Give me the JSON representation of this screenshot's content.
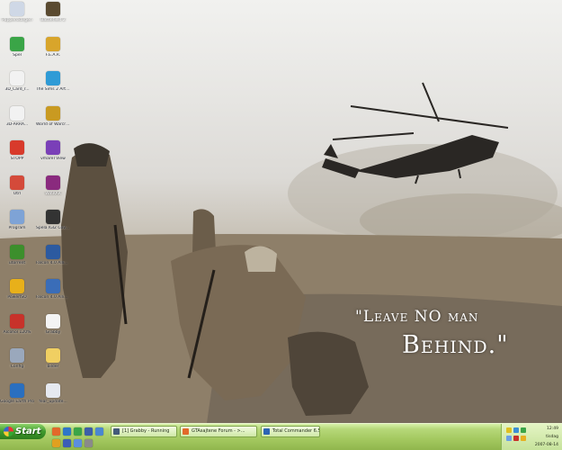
{
  "desktop": {
    "icons": [
      {
        "label": "Papperskorgen",
        "icon": "recycle-bin-icon",
        "color": "#cfd8e6",
        "light": true
      },
      {
        "label": "Battlefield 2",
        "icon": "battlefield-icon",
        "color": "#5a4a30",
        "light": true
      },
      {
        "label": "Spel",
        "icon": "globe-icon",
        "color": "#3aa547",
        "light": false
      },
      {
        "label": "F.E.A.R.",
        "icon": "fear-icon",
        "color": "#d8a52b",
        "light": false
      },
      {
        "label": "3D_Card_r...",
        "icon": "document-icon",
        "color": "#f2f2f2",
        "light": false
      },
      {
        "label": "The Sims 2 Artenliv",
        "icon": "sims-icon",
        "color": "#2f9bd6",
        "light": false
      },
      {
        "label": "3D-ARRA...",
        "icon": "document-icon",
        "color": "#f2f2f2",
        "light": false
      },
      {
        "label": "World of Warcraft",
        "icon": "warcraft-icon",
        "color": "#c99a21",
        "light": false
      },
      {
        "label": "STOPP",
        "icon": "power-icon",
        "color": "#d83a2b",
        "light": false
      },
      {
        "label": "vmareTView",
        "icon": "app-icon",
        "color": "#7a3fb8",
        "light": false
      },
      {
        "label": "Utrl",
        "icon": "shortcut-icon",
        "color": "#d44a3a",
        "light": false
      },
      {
        "label": "WinRAR",
        "icon": "winrar-icon",
        "color": "#8a2a7e",
        "light": true
      },
      {
        "label": "Program",
        "icon": "computer-icon",
        "color": "#7ea3d6",
        "light": false
      },
      {
        "label": "Spela IGI2 Covert Strike",
        "icon": "igi-icon",
        "color": "#333333",
        "light": false
      },
      {
        "label": "utorrent",
        "icon": "utorrent-icon",
        "color": "#3c8f2c",
        "light": false
      },
      {
        "label": "Falcon 4.0 Allied Force",
        "icon": "falcon-icon",
        "color": "#2c5aa0",
        "light": false
      },
      {
        "label": "PowerISO",
        "icon": "poweriso-icon",
        "color": "#e8b01a",
        "light": false
      },
      {
        "label": "Falcon 4.0 Allied Fo...",
        "icon": "falcon-icon",
        "color": "#3a6db8",
        "light": false
      },
      {
        "label": "Alcohol 120%",
        "icon": "alcohol-icon",
        "color": "#c8322a",
        "light": false
      },
      {
        "label": "Grabby",
        "icon": "grabby-icon",
        "color": "#f4f4f4",
        "light": false
      },
      {
        "label": "Config",
        "icon": "config-icon",
        "color": "#9aa8bc",
        "light": false
      },
      {
        "label": "bilder",
        "icon": "folder-icon",
        "color": "#f0cf62",
        "light": false
      },
      {
        "label": "Google Earth Pro",
        "icon": "google-earth-icon",
        "color": "#2a6fbf",
        "light": false
      },
      {
        "label": "fear_update...",
        "icon": "setup-icon",
        "color": "#e6e9f0",
        "light": false
      }
    ],
    "quote": {
      "line1": "\"Leave NO man",
      "line2": "Behind.\""
    }
  },
  "taskbar": {
    "start_label": "Start",
    "quick_launch": [
      {
        "icon": "firefox-icon",
        "color": "#e2682a"
      },
      {
        "icon": "ie-icon",
        "color": "#2f76c9"
      },
      {
        "icon": "messenger-icon",
        "color": "#3aa547"
      },
      {
        "icon": "word-icon",
        "color": "#3c5ea8"
      },
      {
        "icon": "window-icon",
        "color": "#4a87d1"
      },
      {
        "icon": "media-icon",
        "color": "#e0a020"
      },
      {
        "icon": "save-icon",
        "color": "#3b5db7"
      },
      {
        "icon": "network-icon",
        "color": "#5c8ee0"
      },
      {
        "icon": "settings-icon",
        "color": "#8a8a8a"
      }
    ],
    "tasks": [
      {
        "label": "[1] Grabby - Running",
        "icon": "grabby-task-icon",
        "color": "#445a7a"
      },
      {
        "label": "GTAsajtene Forum - >...",
        "icon": "firefox-task-icon",
        "color": "#e2682a"
      },
      {
        "label": "Total Commander 6.5...",
        "icon": "total-commander-icon",
        "color": "#2d64b5"
      }
    ],
    "tray": {
      "icons": [
        {
          "icon": "volume-icon",
          "color": "#e0c020"
        },
        {
          "icon": "network-tray-icon",
          "color": "#3b8fd6"
        },
        {
          "icon": "security-icon",
          "color": "#3aa547"
        },
        {
          "icon": "msn-tray-icon",
          "color": "#6aa0e6"
        },
        {
          "icon": "antivirus-icon",
          "color": "#c8322a"
        },
        {
          "icon": "update-icon",
          "color": "#e6b020"
        }
      ],
      "time": "12:49",
      "day": "tisdag",
      "date": "2007-08-14"
    }
  }
}
